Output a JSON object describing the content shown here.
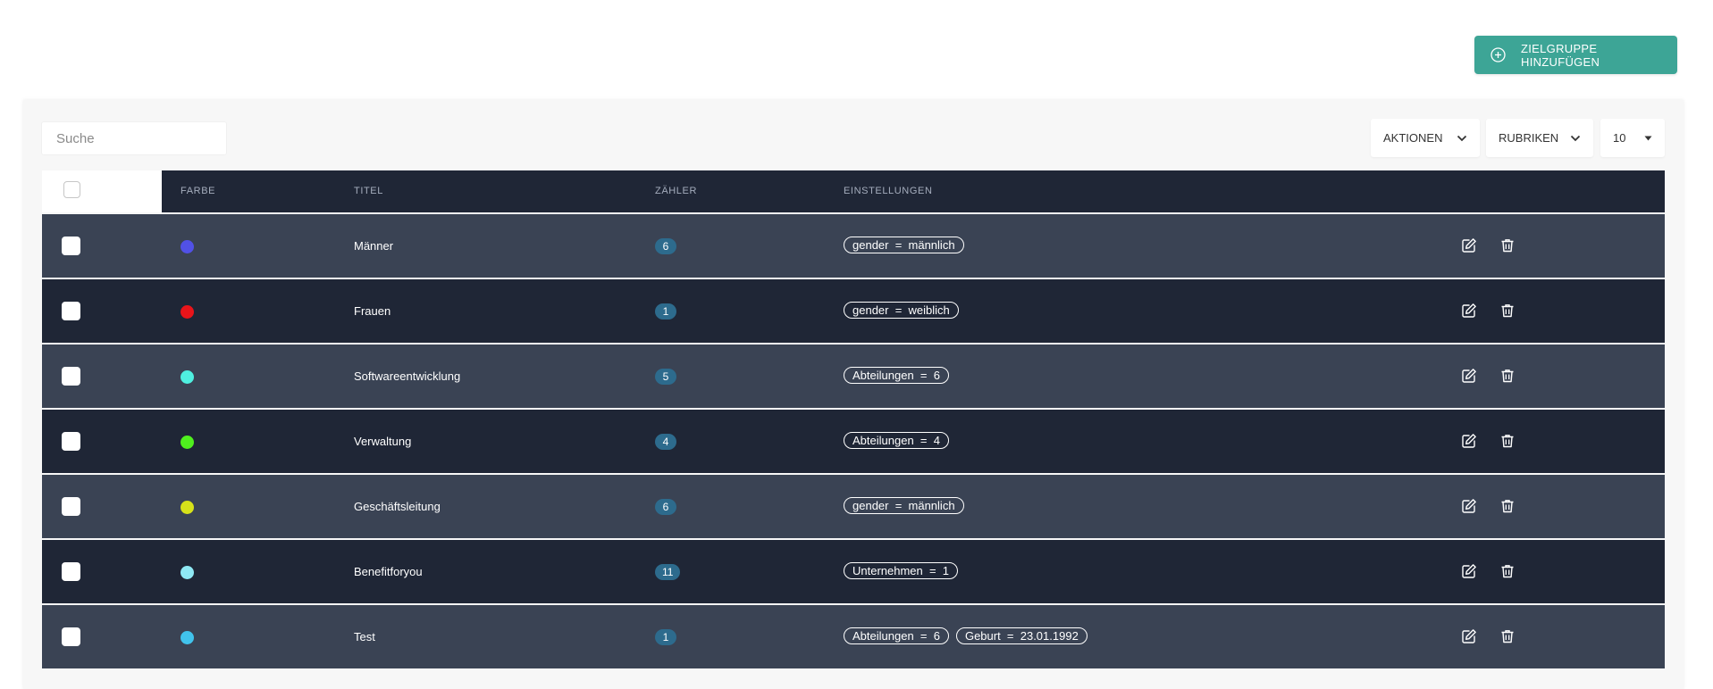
{
  "toolbar": {
    "add_button_label": "ZIELGRUPPE HINZUFÜGEN",
    "search_placeholder": "Suche",
    "actions_label": "AKTIONEN",
    "columns_label": "RUBRIKEN",
    "page_size": "10"
  },
  "table": {
    "headers": {
      "color": "FARBE",
      "title": "TITEL",
      "counter": "ZÄHLER",
      "settings": "EINSTELLUNGEN"
    },
    "rows": [
      {
        "color": "#5151e6",
        "title": "Männer",
        "count": "6",
        "settings": [
          "gender  =  männlich"
        ]
      },
      {
        "color": "#e8141a",
        "title": "Frauen",
        "count": "1",
        "settings": [
          "gender  =  weiblich"
        ]
      },
      {
        "color": "#4ff0e0",
        "title": "Softwareentwicklung",
        "count": "5",
        "settings": [
          "Abteilungen  =  6"
        ]
      },
      {
        "color": "#4fef1e",
        "title": "Verwaltung",
        "count": "4",
        "settings": [
          "Abteilungen  =  4"
        ]
      },
      {
        "color": "#d7e21a",
        "title": "Geschäftsleitung",
        "count": "6",
        "settings": [
          "gender  =  männlich"
        ]
      },
      {
        "color": "#8ee8f4",
        "title": "Benefitforyou",
        "count": "11",
        "settings": [
          "Unternehmen  =  1"
        ]
      },
      {
        "color": "#41c3ec",
        "title": "Test",
        "count": "1",
        "settings": [
          "Abteilungen  =  6",
          "Geburt  =  23.01.1992"
        ]
      }
    ]
  },
  "icons": {
    "add": "plus-circle-icon",
    "dropdown": "chevron-down-icon",
    "edit": "edit-icon",
    "delete": "trash-icon"
  },
  "colors": {
    "accent": "#3da596",
    "header_bg": "#1f2636",
    "row_light": "#3a4354",
    "row_dark": "#1f2636",
    "count_badge": "#2d6b8d"
  }
}
